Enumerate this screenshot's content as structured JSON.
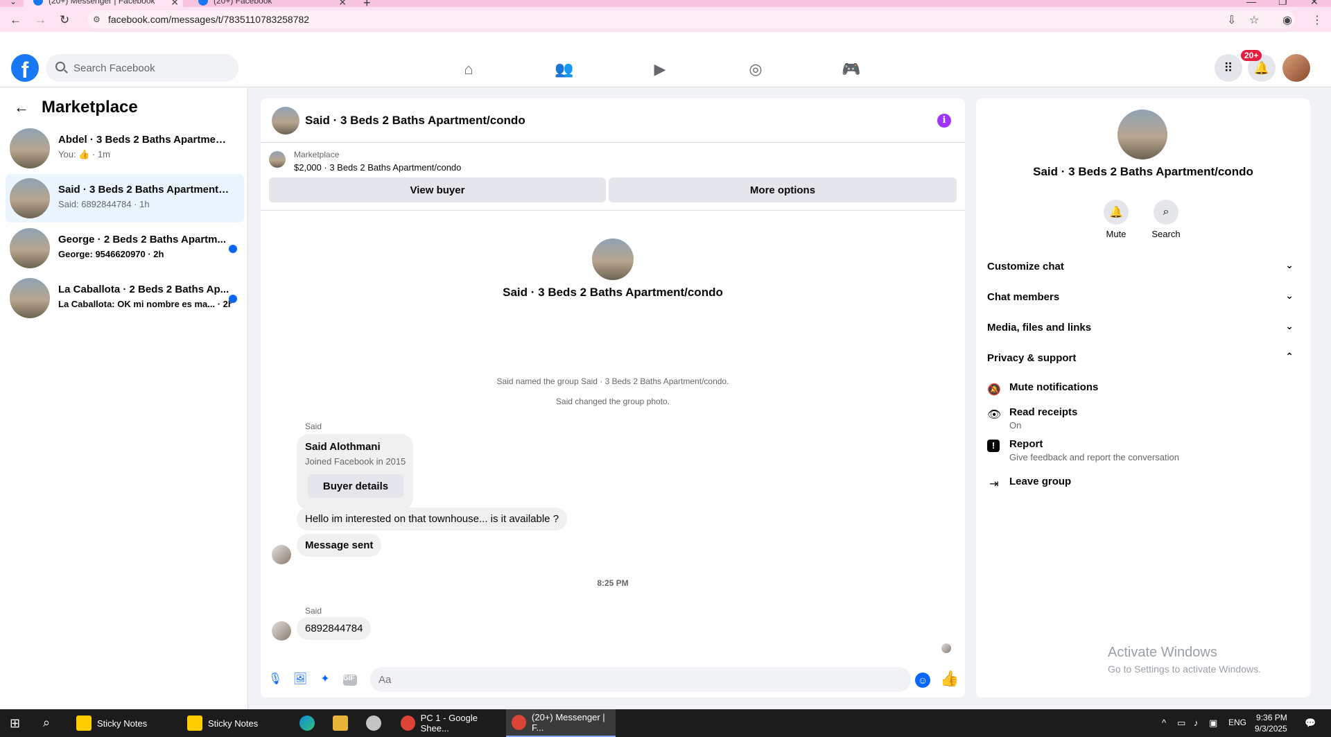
{
  "browser": {
    "tabs": [
      {
        "title": "(20+) Messenger | Facebook",
        "active": true
      },
      {
        "title": "(20+) Facebook",
        "active": false
      }
    ],
    "url": "facebook.com/messages/t/7835110783258782"
  },
  "fb": {
    "search_placeholder": "Search Facebook",
    "notification_badge": "20+"
  },
  "left": {
    "title": "Marketplace",
    "chats": [
      {
        "name": "Abdel · 3 Beds 2 Baths Apartment/...",
        "sub": "You: 👍 · 1m",
        "selected": false,
        "unread": false
      },
      {
        "name": "Said · 3 Beds 2 Baths Apartment/c...",
        "sub": "Said: 6892844784 · 1h",
        "selected": true,
        "unread": false
      },
      {
        "name": "George · 2 Beds 2 Baths Apartm...",
        "sub": "George: 9546620970 · 2h",
        "selected": false,
        "unread": true
      },
      {
        "name": "La Caballota · 2 Beds 2 Baths Ap...",
        "sub": "La Caballota: OK mi nombre es ma... · 2h",
        "selected": false,
        "unread": true
      }
    ]
  },
  "conversation": {
    "title": "Said · 3 Beds 2 Baths Apartment/condo",
    "marketplace_label": "Marketplace",
    "listing": "$2,000 · 3 Beds 2 Baths Apartment/condo",
    "view_buyer": "View buyer",
    "more_options": "More options",
    "intro_name": "Said · 3 Beds 2 Baths Apartment/condo",
    "system_messages": [
      "Said named the group Said · 3 Beds 2 Baths Apartment/condo.",
      "Said changed the group photo."
    ],
    "sender_1": "Said",
    "card": {
      "name": "Said Alothmani",
      "joined": "Joined Facebook in 2015",
      "button": "Buyer details"
    },
    "msg_1": "Hello im interested on that townhouse... is it available ?",
    "msg_2": "Message sent",
    "time_separator": "8:25 PM",
    "sender_2": "Said",
    "msg_3": "6892844784",
    "composer_placeholder": "Aa"
  },
  "info": {
    "name": "Said · 3 Beds 2 Baths Apartment/condo",
    "mute_label": "Mute",
    "search_label": "Search",
    "sections": [
      "Customize chat",
      "Chat members",
      "Media, files and links",
      "Privacy & support"
    ],
    "privacy_items": [
      {
        "title": "Mute notifications",
        "sub": ""
      },
      {
        "title": "Read receipts",
        "sub": "On"
      },
      {
        "title": "Report",
        "sub": "Give feedback and report the conversation"
      },
      {
        "title": "Leave group",
        "sub": ""
      }
    ]
  },
  "watermark": {
    "line1": "Activate Windows",
    "line2": "Go to Settings to activate Windows."
  },
  "taskbar": {
    "items": [
      "Sticky Notes",
      "Sticky Notes",
      "PC 1 - Google Shee...",
      "(20+) Messenger | F..."
    ],
    "lang": "ENG",
    "time": "9:36 PM",
    "date": "9/3/2025"
  },
  "colors": {
    "fb_blue": "#1877f2",
    "messenger_blue": "#0866ff",
    "info_purple": "#a033ff",
    "badge_red": "#e41e3f"
  }
}
